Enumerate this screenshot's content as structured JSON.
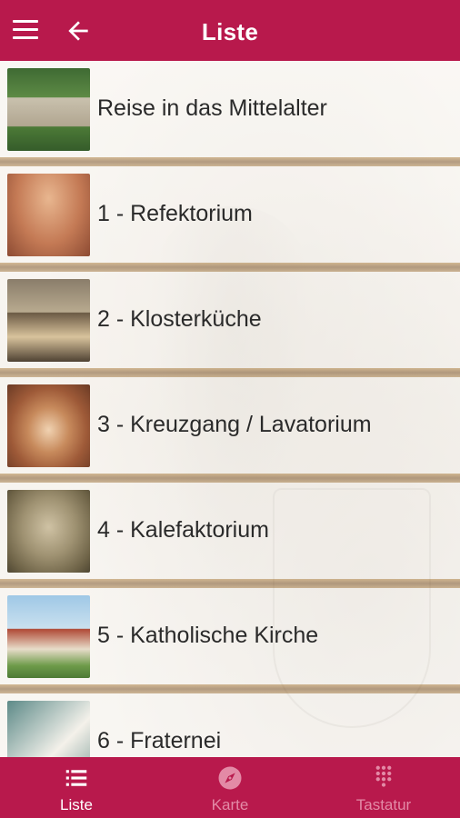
{
  "colors": {
    "primary": "#b8194c",
    "inactive_tab": "#e38aa6"
  },
  "appbar": {
    "title": "Liste",
    "menu_icon": "hamburger-icon",
    "back_icon": "arrow-left-icon"
  },
  "list": {
    "items": [
      {
        "label": "Reise in das Mittelalter",
        "thumb": "monastery-aerial-photo"
      },
      {
        "label": "1 - Refektorium",
        "thumb": "vaulted-hall-photo"
      },
      {
        "label": "2 - Klosterküche",
        "thumb": "kitchen-photo"
      },
      {
        "label": "3 - Kreuzgang / Lavatorium",
        "thumb": "cloister-arches-photo"
      },
      {
        "label": "4 - Kalefaktorium",
        "thumb": "vaulted-cellar-photo"
      },
      {
        "label": "5 - Katholische Kirche",
        "thumb": "church-photo"
      },
      {
        "label": "6 - Fraternei",
        "thumb": "fraternei-photo"
      }
    ]
  },
  "bottom_nav": {
    "tabs": [
      {
        "label": "Liste",
        "icon": "list-icon",
        "active": true
      },
      {
        "label": "Karte",
        "icon": "compass-icon",
        "active": false
      },
      {
        "label": "Tastatur",
        "icon": "keypad-icon",
        "active": false
      }
    ]
  }
}
